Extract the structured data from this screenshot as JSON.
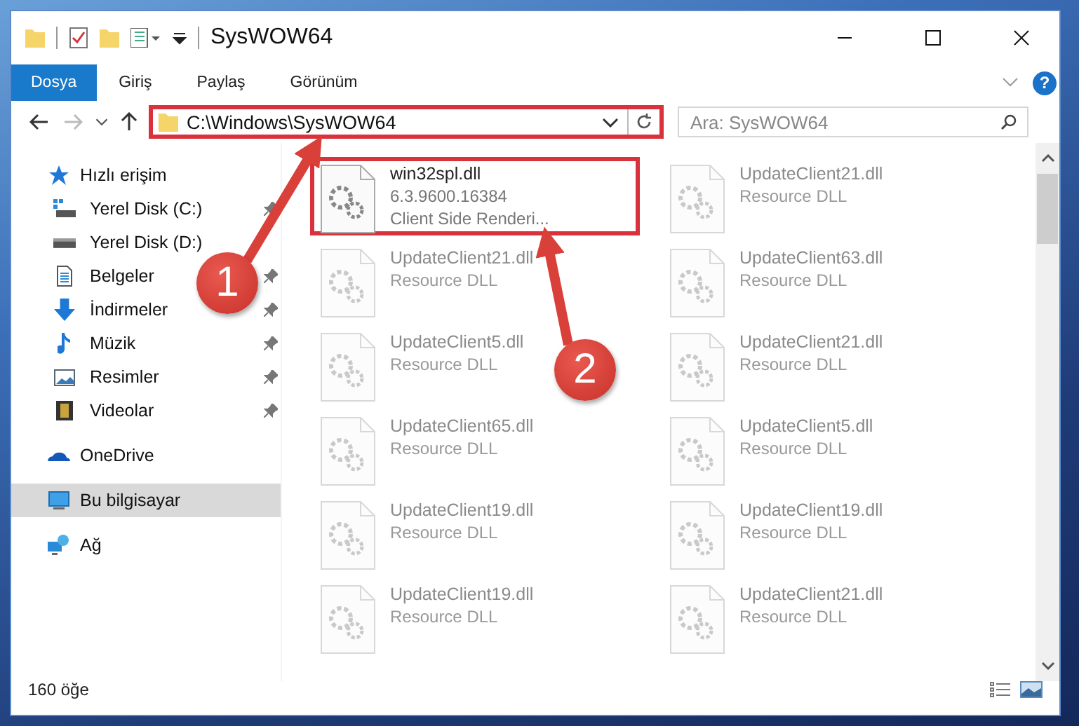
{
  "window": {
    "title": "SysWOW64"
  },
  "ribbon_tabs": [
    {
      "label": "Dosya",
      "selected": true
    },
    {
      "label": "Giriş",
      "selected": false
    },
    {
      "label": "Paylaş",
      "selected": false
    },
    {
      "label": "Görünüm",
      "selected": false
    }
  ],
  "help": "?",
  "address": {
    "value": "C:\\Windows\\SysWOW64"
  },
  "search": {
    "placeholder": "Ara: SysWOW64"
  },
  "nav": [
    {
      "label": "Hızlı erişim",
      "selected": false,
      "children": [
        {
          "label": "Yerel Disk (C:)",
          "pinned": true,
          "selected": false
        },
        {
          "label": "Yerel Disk (D:)",
          "pinned": false,
          "selected": false
        },
        {
          "label": "Belgeler",
          "pinned": true,
          "selected": false
        },
        {
          "label": "İndirmeler",
          "pinned": true,
          "selected": false
        },
        {
          "label": "Müzik",
          "pinned": true,
          "selected": false
        },
        {
          "label": "Resimler",
          "pinned": true,
          "selected": false
        },
        {
          "label": "Videolar",
          "pinned": true,
          "selected": false
        }
      ]
    },
    {
      "label": "OneDrive",
      "selected": false
    },
    {
      "label": "Bu bilgisayar",
      "selected": true
    },
    {
      "label": "Ağ",
      "selected": false
    }
  ],
  "files": [
    {
      "name": "win32spl.dll",
      "details": [
        "6.3.9600.16384",
        "Client Side Renderi..."
      ],
      "dimmed": false
    },
    {
      "name": "UpdateClient21.dll",
      "details": [
        "Resource DLL"
      ],
      "dimmed": true
    },
    {
      "name": "UpdateClient21.dll",
      "details": [
        "Resource DLL"
      ],
      "dimmed": true
    },
    {
      "name": "UpdateClient63.dll",
      "details": [
        "Resource DLL"
      ],
      "dimmed": true
    },
    {
      "name": "UpdateClient5.dll",
      "details": [
        "Resource DLL"
      ],
      "dimmed": true
    },
    {
      "name": "UpdateClient21.dll",
      "details": [
        "Resource DLL"
      ],
      "dimmed": true
    },
    {
      "name": "UpdateClient65.dll",
      "details": [
        "Resource DLL"
      ],
      "dimmed": true
    },
    {
      "name": "UpdateClient5.dll",
      "details": [
        "Resource DLL"
      ],
      "dimmed": true
    },
    {
      "name": "UpdateClient19.dll",
      "details": [
        "Resource DLL"
      ],
      "dimmed": true
    },
    {
      "name": "UpdateClient19.dll",
      "details": [
        "Resource DLL"
      ],
      "dimmed": true
    },
    {
      "name": "UpdateClient19.dll",
      "details": [
        "Resource DLL"
      ],
      "dimmed": true
    },
    {
      "name": "UpdateClient21.dll",
      "details": [
        "Resource DLL"
      ],
      "dimmed": true
    }
  ],
  "status_bar": {
    "count": "160 öğe"
  },
  "callouts": [
    {
      "number": "1"
    },
    {
      "number": "2"
    }
  ]
}
